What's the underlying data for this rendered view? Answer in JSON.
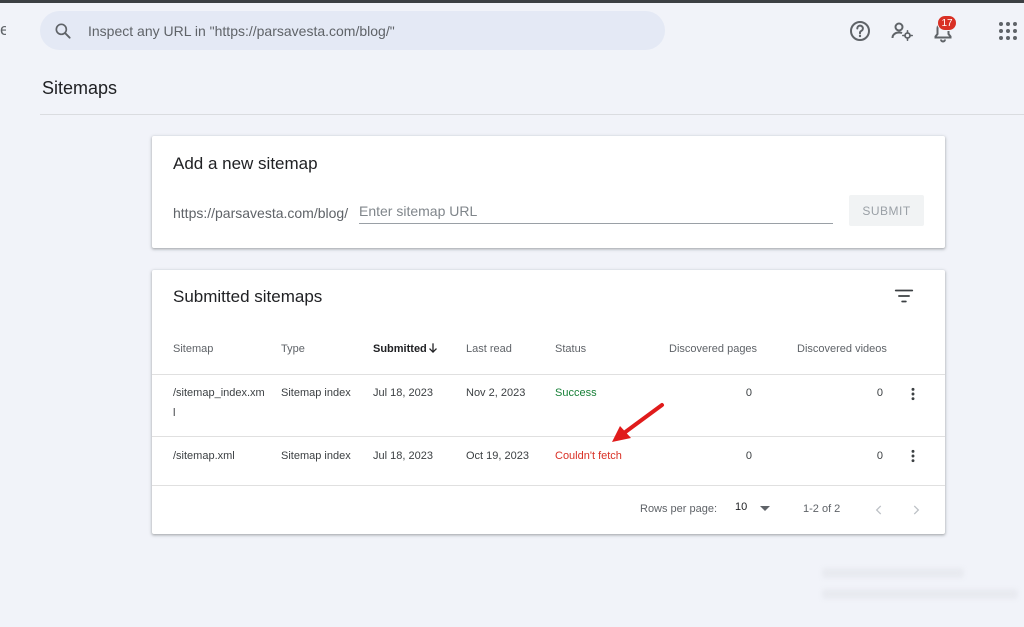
{
  "header": {
    "search_placeholder": "Inspect any URL in \"https://parsavesta.com/blog/\"",
    "notification_count": "17",
    "edge_glyph": "e",
    "icons": [
      "search-icon",
      "help-icon",
      "manage-users-icon",
      "notifications-icon",
      "apps-grid-icon"
    ]
  },
  "page": {
    "title": "Sitemaps"
  },
  "add_sitemap": {
    "title": "Add a new sitemap",
    "url_prefix": "https://parsavesta.com/blog/",
    "input_placeholder": "Enter sitemap URL",
    "submit_label": "SUBMIT"
  },
  "submitted": {
    "title": "Submitted sitemaps",
    "columns": [
      "Sitemap",
      "Type",
      "Submitted",
      "Last read",
      "Status",
      "Discovered pages",
      "Discovered videos"
    ],
    "rows": [
      {
        "sitemap": "/sitemap_index.xml",
        "type": "Sitemap index",
        "submitted": "Jul 18, 2023",
        "last_read": "Nov 2, 2023",
        "status": "Success",
        "pages": "0",
        "videos": "0"
      },
      {
        "sitemap": "/sitemap.xml",
        "type": "Sitemap index",
        "submitted": "Jul 18, 2023",
        "last_read": "Oct 19, 2023",
        "status": "Couldn't fetch",
        "pages": "0",
        "videos": "0"
      }
    ],
    "footer": {
      "rows_per_page_label": "Rows per page:",
      "rows_per_page_value": "10",
      "range": "1-2 of 2"
    }
  },
  "colors": {
    "success": "#188038",
    "error": "#d93025",
    "annotation_arrow": "#e01b1b"
  }
}
